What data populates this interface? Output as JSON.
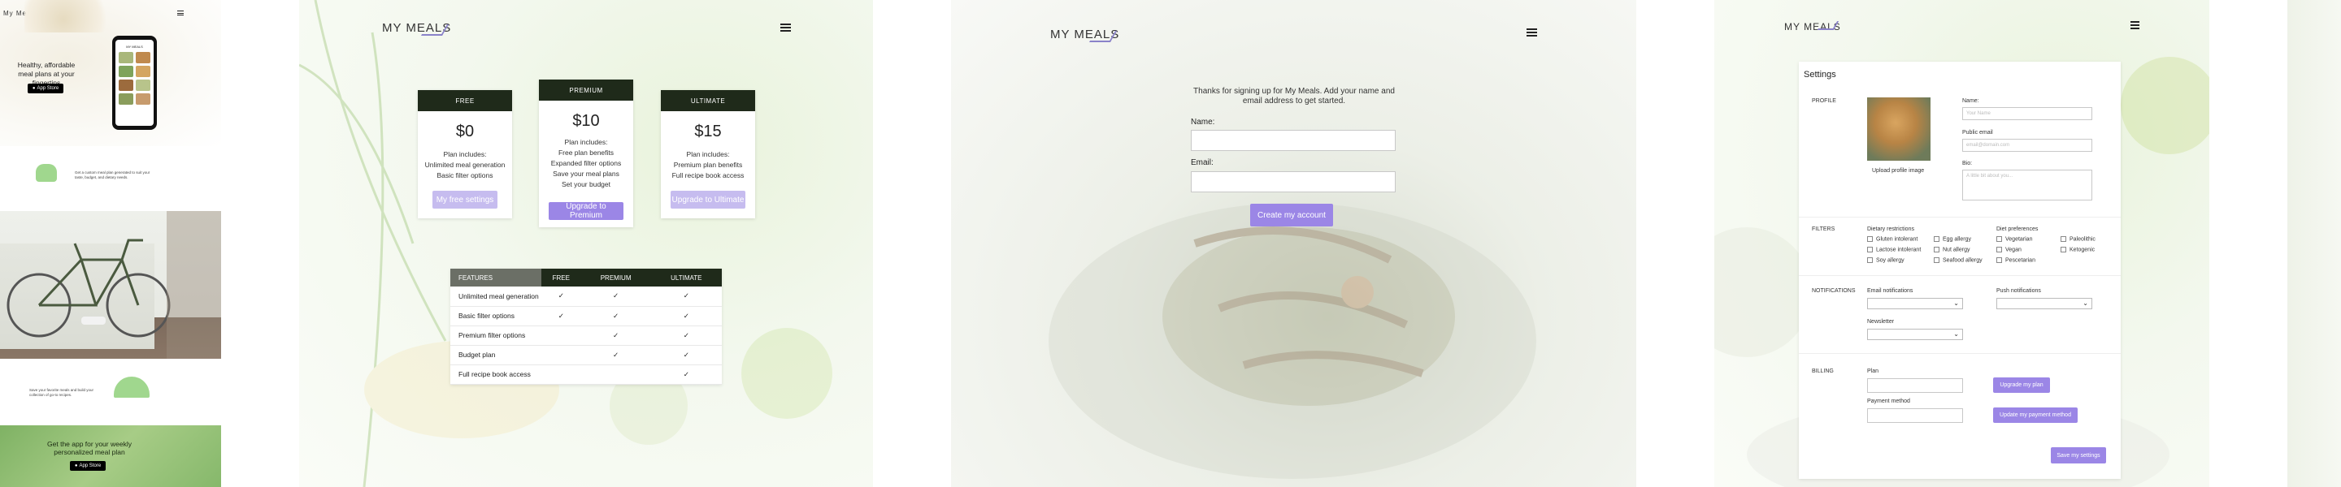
{
  "brand": {
    "logo_text": "MY MEALS",
    "accent": "#9b86e6",
    "dark": "#1f2a1a"
  },
  "landing": {
    "logo_text": "My Meals",
    "hero_text": "Healthy, affordable meal plans at your fingertips",
    "app_store_label": "App Store",
    "feature1_text": "Get a custom meal plan generated to suit your taste, budget, and dietary needs.",
    "feature2_text": "Save your favorite meals and build your collection of go-to recipes.",
    "cta_text": "Get the app for your weekly personalized meal plan",
    "cta_store_label": "App Store",
    "phone_logo": "MY MEALS"
  },
  "pricing": {
    "plans": [
      {
        "name": "FREE",
        "price": "$0",
        "features": [
          "Plan includes:",
          "Unlimited meal generation",
          "Basic filter options"
        ],
        "button": "My free settings",
        "button_disabled": true
      },
      {
        "name": "PREMIUM",
        "price": "$10",
        "features": [
          "Plan includes:",
          "Free plan benefits",
          "Expanded filter options",
          "Save your meal plans",
          "Set your budget"
        ],
        "button": "Upgrade to Premium",
        "button_disabled": false
      },
      {
        "name": "ULTIMATE",
        "price": "$15",
        "features": [
          "Plan includes:",
          "Premium plan benefits",
          "Full recipe book access"
        ],
        "button": "Upgrade to Ultimate",
        "button_disabled": true
      }
    ],
    "table": {
      "headers": [
        "FEATURES",
        "FREE",
        "PREMIUM",
        "ULTIMATE"
      ],
      "rows": [
        {
          "feature": "Unlimited meal generation",
          "free": "✓",
          "premium": "✓",
          "ultimate": "✓"
        },
        {
          "feature": "Basic filter options",
          "free": "✓",
          "premium": "✓",
          "ultimate": "✓"
        },
        {
          "feature": "Premium filter options",
          "free": "",
          "premium": "✓",
          "ultimate": "✓"
        },
        {
          "feature": "Budget plan",
          "free": "",
          "premium": "✓",
          "ultimate": "✓"
        },
        {
          "feature": "Full recipe book access",
          "free": "",
          "premium": "",
          "ultimate": "✓"
        }
      ]
    }
  },
  "signup": {
    "intro": "Thanks for signing up for My Meals. Add your name and email address to get started.",
    "name_label": "Name:",
    "email_label": "Email:",
    "submit": "Create my account"
  },
  "settings": {
    "title": "Settings",
    "profile": {
      "section": "PROFILE",
      "upload_label": "Upload profile image",
      "name_label": "Name:",
      "name_placeholder": "Your Name",
      "email_label": "Public email",
      "email_placeholder": "email@domain.com",
      "bio_label": "Bio:",
      "bio_placeholder": "A little bit about you..."
    },
    "filters": {
      "section": "FILTERS",
      "dietary_label": "Dietary restrictions",
      "dietary_col1": [
        "Gluten intolerant",
        "Lactose intolerant",
        "Soy allergy"
      ],
      "dietary_col2": [
        "Egg allergy",
        "Nut allergy",
        "Seafood allergy"
      ],
      "diet_label": "Diet preferences",
      "diet_col1": [
        "Vegetarian",
        "Vegan",
        "Pescetarian"
      ],
      "diet_col2": [
        "Paleolithic",
        "Ketogenic"
      ]
    },
    "notifications": {
      "section": "NOTIFICATIONS",
      "email_label": "Email notifications",
      "push_label": "Push notifications",
      "newsletter_label": "Newsletter"
    },
    "billing": {
      "section": "BILLING",
      "plan_label": "Plan",
      "upgrade_button": "Upgrade my plan",
      "payment_label": "Payment method",
      "update_payment_button": "Update my payment method",
      "save_button": "Save my settings"
    }
  }
}
